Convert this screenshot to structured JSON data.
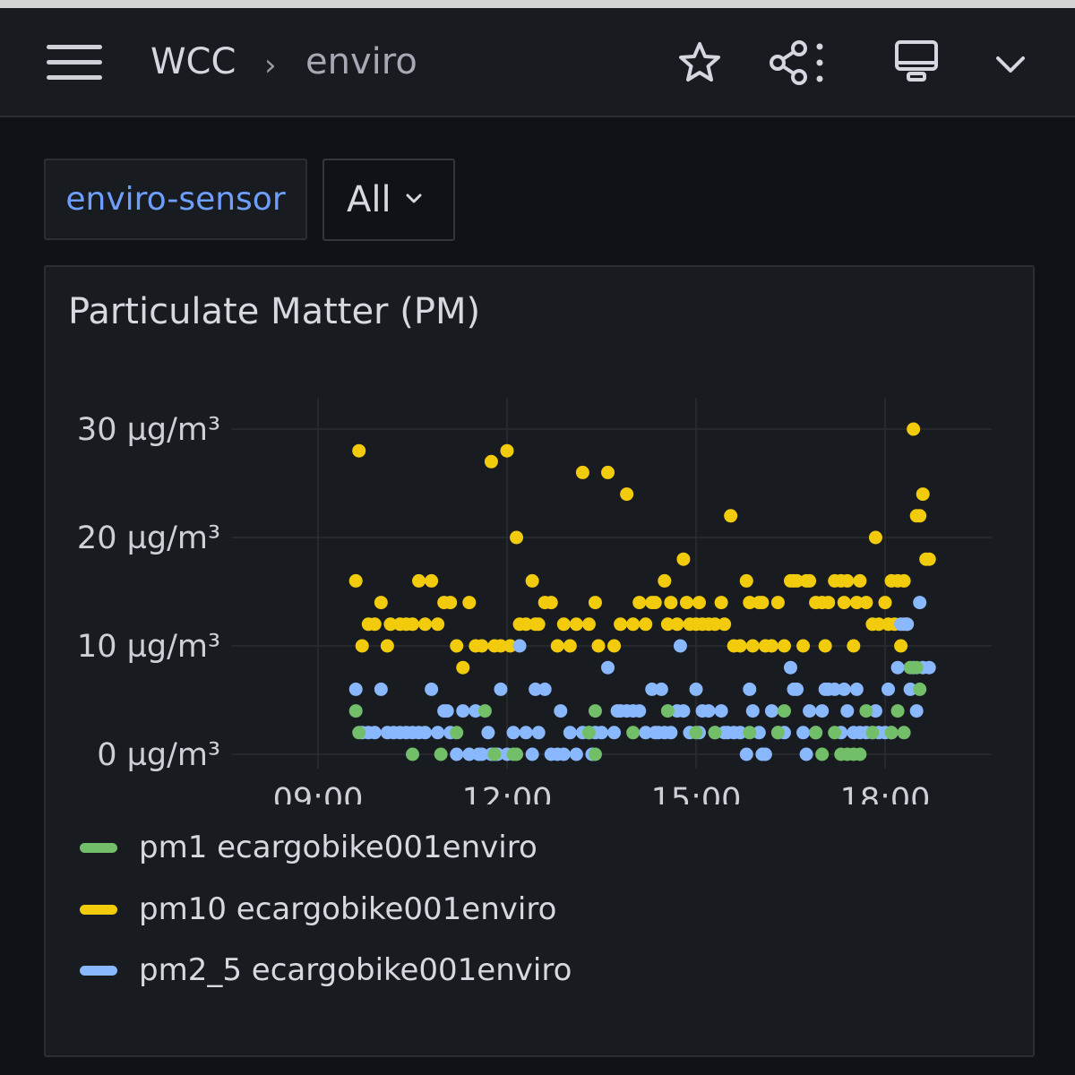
{
  "header": {
    "breadcrumb": [
      "WCC",
      "enviro"
    ],
    "separator": "›",
    "icons": [
      "menu-icon",
      "star-icon",
      "share-icon",
      "tv-mode-icon",
      "chevron-down-icon"
    ]
  },
  "variables": {
    "label": "enviro-sensor",
    "value": "All"
  },
  "panel": {
    "title": "Particulate Matter (PM)"
  },
  "colors": {
    "pm1": "#73bf69",
    "pm10": "#f2cc0c",
    "pm2_5": "#8ab8ff",
    "background": "#111217",
    "panel": "#181b1f",
    "grid": "#2a2c31"
  },
  "chart_data": {
    "type": "scatter",
    "x_unit": "hours",
    "x_ticks": [
      "09:00",
      "12:00",
      "15:00",
      "18:00"
    ],
    "x_tick_values": [
      9,
      12,
      15,
      18
    ],
    "y_ticks": [
      "0 µg/m³",
      "10 µg/m³",
      "20 µg/m³",
      "30 µg/m³"
    ],
    "y_tick_values": [
      0,
      10,
      20,
      30
    ],
    "xlim": [
      8.0,
      18.35
    ],
    "ylim": [
      -1,
      33
    ],
    "grid": true,
    "legend_position": "bottom",
    "series": [
      {
        "name": "pm1 ecargobike001enviro",
        "color": "#73bf69",
        "points": [
          [
            9.6,
            4
          ],
          [
            9.65,
            2
          ],
          [
            10.5,
            0
          ],
          [
            10.95,
            0
          ],
          [
            11.2,
            2
          ],
          [
            11.65,
            4
          ],
          [
            11.8,
            0
          ],
          [
            12.1,
            0
          ],
          [
            12.15,
            0
          ],
          [
            13.4,
            0
          ],
          [
            13.3,
            2
          ],
          [
            13.4,
            4
          ],
          [
            14.0,
            2
          ],
          [
            14.55,
            4
          ],
          [
            15.0,
            2
          ],
          [
            15.3,
            2
          ],
          [
            15.85,
            2
          ],
          [
            16.3,
            2
          ],
          [
            16.4,
            4
          ],
          [
            16.9,
            2
          ],
          [
            17.0,
            0
          ],
          [
            17.2,
            2
          ],
          [
            17.3,
            0
          ],
          [
            17.4,
            0
          ],
          [
            17.5,
            0
          ],
          [
            17.6,
            0
          ],
          [
            17.7,
            4
          ],
          [
            17.8,
            2
          ],
          [
            18.1,
            2
          ],
          [
            18.2,
            4
          ],
          [
            18.3,
            2
          ],
          [
            18.4,
            8
          ],
          [
            18.5,
            8
          ],
          [
            18.55,
            6
          ]
        ]
      },
      {
        "name": "pm10 ecargobike001enviro",
        "color": "#f2cc0c",
        "points": [
          [
            9.6,
            16
          ],
          [
            9.65,
            28
          ],
          [
            9.7,
            10
          ],
          [
            9.8,
            12
          ],
          [
            9.9,
            12
          ],
          [
            10.0,
            14
          ],
          [
            10.1,
            10
          ],
          [
            10.15,
            12
          ],
          [
            10.3,
            12
          ],
          [
            10.4,
            12
          ],
          [
            10.5,
            12
          ],
          [
            10.6,
            16
          ],
          [
            10.7,
            12
          ],
          [
            10.8,
            16
          ],
          [
            10.9,
            12
          ],
          [
            11.0,
            14
          ],
          [
            11.1,
            14
          ],
          [
            11.2,
            10
          ],
          [
            11.3,
            8
          ],
          [
            11.4,
            14
          ],
          [
            11.5,
            10
          ],
          [
            11.6,
            10
          ],
          [
            11.75,
            27
          ],
          [
            11.8,
            10
          ],
          [
            11.9,
            10
          ],
          [
            12.0,
            28
          ],
          [
            12.05,
            10
          ],
          [
            12.15,
            20
          ],
          [
            12.2,
            12
          ],
          [
            12.3,
            12
          ],
          [
            12.4,
            16
          ],
          [
            12.45,
            12
          ],
          [
            12.5,
            12
          ],
          [
            12.6,
            14
          ],
          [
            12.7,
            14
          ],
          [
            12.8,
            10
          ],
          [
            12.9,
            12
          ],
          [
            13.0,
            10
          ],
          [
            13.1,
            12
          ],
          [
            13.2,
            26
          ],
          [
            13.3,
            12
          ],
          [
            13.4,
            14
          ],
          [
            13.45,
            10
          ],
          [
            13.6,
            26
          ],
          [
            13.7,
            10
          ],
          [
            13.8,
            12
          ],
          [
            13.9,
            24
          ],
          [
            14.0,
            12
          ],
          [
            14.1,
            14
          ],
          [
            14.2,
            12
          ],
          [
            14.3,
            14
          ],
          [
            14.35,
            14
          ],
          [
            14.5,
            16
          ],
          [
            14.55,
            12
          ],
          [
            14.6,
            14
          ],
          [
            14.7,
            12
          ],
          [
            14.8,
            18
          ],
          [
            14.85,
            14
          ],
          [
            14.9,
            12
          ],
          [
            15.0,
            12
          ],
          [
            15.05,
            14
          ],
          [
            15.1,
            12
          ],
          [
            15.2,
            12
          ],
          [
            15.3,
            12
          ],
          [
            15.4,
            14
          ],
          [
            15.45,
            12
          ],
          [
            15.55,
            22
          ],
          [
            15.6,
            10
          ],
          [
            15.7,
            10
          ],
          [
            15.8,
            16
          ],
          [
            15.85,
            14
          ],
          [
            15.9,
            10
          ],
          [
            16.0,
            14
          ],
          [
            16.05,
            14
          ],
          [
            16.1,
            10
          ],
          [
            16.2,
            10
          ],
          [
            16.3,
            14
          ],
          [
            16.4,
            10
          ],
          [
            16.5,
            16
          ],
          [
            16.55,
            16
          ],
          [
            16.6,
            16
          ],
          [
            16.7,
            10
          ],
          [
            16.75,
            16
          ],
          [
            16.8,
            16
          ],
          [
            16.9,
            14
          ],
          [
            17.0,
            14
          ],
          [
            17.05,
            10
          ],
          [
            17.1,
            14
          ],
          [
            17.2,
            16
          ],
          [
            17.3,
            16
          ],
          [
            17.35,
            14
          ],
          [
            17.4,
            16
          ],
          [
            17.5,
            10
          ],
          [
            17.55,
            14
          ],
          [
            17.6,
            16
          ],
          [
            17.7,
            14
          ],
          [
            17.8,
            12
          ],
          [
            17.85,
            20
          ],
          [
            17.9,
            12
          ],
          [
            18.0,
            14
          ],
          [
            18.05,
            12
          ],
          [
            18.1,
            16
          ],
          [
            18.15,
            12
          ],
          [
            18.2,
            16
          ],
          [
            18.25,
            10
          ],
          [
            18.3,
            16
          ],
          [
            18.35,
            12
          ],
          [
            18.45,
            30
          ],
          [
            18.5,
            22
          ],
          [
            18.55,
            22
          ],
          [
            18.6,
            24
          ],
          [
            18.65,
            18
          ],
          [
            18.7,
            18
          ]
        ]
      },
      {
        "name": "pm2_5 ecargobike001enviro",
        "color": "#8ab8ff",
        "points": [
          [
            9.6,
            6
          ],
          [
            9.7,
            2
          ],
          [
            9.8,
            2
          ],
          [
            9.9,
            2
          ],
          [
            10.0,
            6
          ],
          [
            10.1,
            2
          ],
          [
            10.2,
            2
          ],
          [
            10.3,
            2
          ],
          [
            10.4,
            2
          ],
          [
            10.5,
            2
          ],
          [
            10.6,
            2
          ],
          [
            10.7,
            2
          ],
          [
            10.8,
            6
          ],
          [
            10.9,
            2
          ],
          [
            11.0,
            4
          ],
          [
            11.05,
            4
          ],
          [
            11.1,
            2
          ],
          [
            11.2,
            0
          ],
          [
            11.3,
            4
          ],
          [
            11.4,
            0
          ],
          [
            11.5,
            4
          ],
          [
            11.55,
            0
          ],
          [
            11.6,
            0
          ],
          [
            11.7,
            2
          ],
          [
            11.75,
            0
          ],
          [
            11.8,
            0
          ],
          [
            11.85,
            0
          ],
          [
            11.9,
            6
          ],
          [
            12.0,
            0
          ],
          [
            12.1,
            2
          ],
          [
            12.2,
            10
          ],
          [
            12.3,
            2
          ],
          [
            12.4,
            0
          ],
          [
            12.45,
            6
          ],
          [
            12.5,
            2
          ],
          [
            12.6,
            6
          ],
          [
            12.7,
            0
          ],
          [
            12.8,
            0
          ],
          [
            12.85,
            4
          ],
          [
            12.9,
            0
          ],
          [
            13.0,
            2
          ],
          [
            13.1,
            0
          ],
          [
            13.2,
            2
          ],
          [
            13.3,
            2
          ],
          [
            13.35,
            0
          ],
          [
            13.4,
            2
          ],
          [
            13.5,
            2
          ],
          [
            13.6,
            8
          ],
          [
            13.7,
            2
          ],
          [
            13.75,
            4
          ],
          [
            13.8,
            4
          ],
          [
            13.9,
            4
          ],
          [
            14.0,
            4
          ],
          [
            14.1,
            4
          ],
          [
            14.2,
            2
          ],
          [
            14.3,
            6
          ],
          [
            14.35,
            2
          ],
          [
            14.4,
            2
          ],
          [
            14.45,
            6
          ],
          [
            14.5,
            2
          ],
          [
            14.6,
            2
          ],
          [
            14.7,
            4
          ],
          [
            14.75,
            10
          ],
          [
            14.8,
            4
          ],
          [
            14.9,
            2
          ],
          [
            15.0,
            6
          ],
          [
            15.05,
            2
          ],
          [
            15.1,
            4
          ],
          [
            15.2,
            4
          ],
          [
            15.3,
            2
          ],
          [
            15.4,
            4
          ],
          [
            15.45,
            2
          ],
          [
            15.5,
            2
          ],
          [
            15.6,
            2
          ],
          [
            15.7,
            2
          ],
          [
            15.8,
            0
          ],
          [
            15.85,
            6
          ],
          [
            15.9,
            4
          ],
          [
            16.0,
            2
          ],
          [
            16.05,
            0
          ],
          [
            16.1,
            0
          ],
          [
            16.2,
            4
          ],
          [
            16.3,
            2
          ],
          [
            16.4,
            2
          ],
          [
            16.5,
            8
          ],
          [
            16.55,
            6
          ],
          [
            16.6,
            6
          ],
          [
            16.7,
            2
          ],
          [
            16.75,
            0
          ],
          [
            16.8,
            4
          ],
          [
            16.9,
            2
          ],
          [
            17.0,
            4
          ],
          [
            17.05,
            6
          ],
          [
            17.1,
            6
          ],
          [
            17.2,
            6
          ],
          [
            17.3,
            2
          ],
          [
            17.35,
            6
          ],
          [
            17.4,
            4
          ],
          [
            17.5,
            2
          ],
          [
            17.55,
            6
          ],
          [
            17.6,
            2
          ],
          [
            17.7,
            2
          ],
          [
            17.8,
            2
          ],
          [
            17.85,
            4
          ],
          [
            17.9,
            2
          ],
          [
            18.0,
            2
          ],
          [
            18.05,
            6
          ],
          [
            18.1,
            2
          ],
          [
            18.2,
            8
          ],
          [
            18.25,
            12
          ],
          [
            18.3,
            12
          ],
          [
            18.35,
            12
          ],
          [
            18.4,
            6
          ],
          [
            18.45,
            8
          ],
          [
            18.5,
            4
          ],
          [
            18.55,
            14
          ],
          [
            18.6,
            8
          ],
          [
            18.7,
            8
          ]
        ]
      }
    ]
  }
}
